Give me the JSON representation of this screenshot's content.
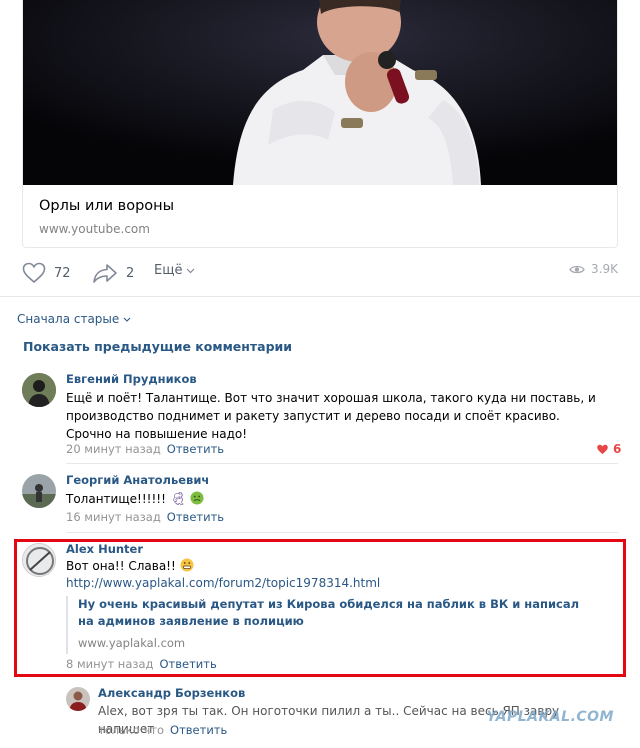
{
  "video_card": {
    "title": "Орлы или вороны",
    "url": "www.youtube.com"
  },
  "actions": {
    "likes": "72",
    "shares": "2",
    "more": "Ещё",
    "views": "3.9K"
  },
  "comments_header": {
    "sort": "Сначала старые",
    "show_previous": "Показать предыдущие комментарии"
  },
  "comments": [
    {
      "author": "Евгений Прудников",
      "text": "Ещё и поёт! Талантище. Вот что значит хорошая школа, такого куда ни поставь, и производство поднимет и ракету запустит и дерево посади и споёт красиво. Срочно на повышение надо!",
      "time": "20 минут назад",
      "reply": "Ответить",
      "likes": "6"
    },
    {
      "author": "Георгий Анатольевич",
      "text": "Толантище!!!!!!",
      "time": "16 минут назад",
      "reply": "Ответить"
    },
    {
      "author": "Alex Hunter",
      "text": "Вот она!! Слава!!",
      "link": "http://www.yaplakal.com/forum2/topic1978314.html",
      "quote_title": "Ну очень красивый депутат из Кирова обиделся на паблик в ВК и написал на админов заявление в полицию",
      "quote_url": "www.yaplakal.com",
      "time": "8 минут назад",
      "reply": "Ответить"
    },
    {
      "author": "Александр Борзенков",
      "text": "Alex, вот зря ты так. Он ноготочки пилил а ты.. Сейчас на весь ЯП завру напишет",
      "time": "только что",
      "reply": "Ответить"
    }
  ],
  "watermark": "YAPLAKAL.COM",
  "colors": {
    "link": "#2a5885",
    "muted": "#939393",
    "highlight_border": "#e30613",
    "like_red": "#e64646"
  }
}
